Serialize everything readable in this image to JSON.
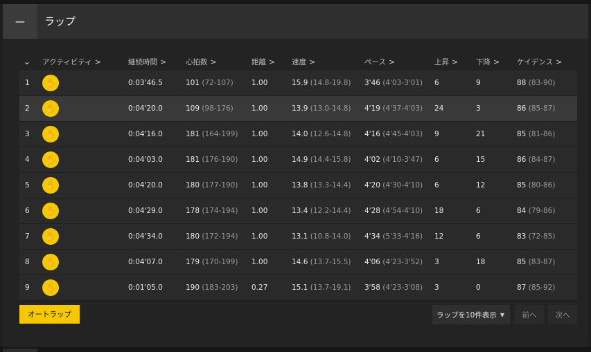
{
  "panel": {
    "title": "ラップ",
    "collapse_symbol": "−"
  },
  "table": {
    "columns": [
      {
        "label": "アクティビティ"
      },
      {
        "label": "継続時間"
      },
      {
        "label": "心拍数"
      },
      {
        "label": "距離"
      },
      {
        "label": "速度"
      },
      {
        "label": "ペース"
      },
      {
        "label": "上昇"
      },
      {
        "label": "下降"
      },
      {
        "label": "ケイデンス"
      }
    ],
    "chevron": ">",
    "sort_toggle": "⌄",
    "rows": [
      {
        "num": "1",
        "duration": "0:03'46.5",
        "hr": "101",
        "hr_range": "(72-107)",
        "distance": "1.00",
        "speed": "15.9",
        "speed_range": "(14.8-19.8)",
        "pace": "3'46",
        "pace_range": "(4'03-3'01)",
        "ascent": "6",
        "descent": "9",
        "cadence": "88",
        "cadence_range": "(83-90)"
      },
      {
        "num": "2",
        "duration": "0:04'20.0",
        "hr": "109",
        "hr_range": "(98-176)",
        "distance": "1.00",
        "speed": "13.9",
        "speed_range": "(13.0-14.8)",
        "pace": "4'19",
        "pace_range": "(4'37-4'03)",
        "ascent": "24",
        "descent": "3",
        "cadence": "86",
        "cadence_range": "(85-87)"
      },
      {
        "num": "3",
        "duration": "0:04'16.0",
        "hr": "181",
        "hr_range": "(164-199)",
        "distance": "1.00",
        "speed": "14.0",
        "speed_range": "(12.6-14.8)",
        "pace": "4'16",
        "pace_range": "(4'45-4'03)",
        "ascent": "9",
        "descent": "21",
        "cadence": "85",
        "cadence_range": "(81-86)"
      },
      {
        "num": "4",
        "duration": "0:04'03.0",
        "hr": "181",
        "hr_range": "(176-190)",
        "distance": "1.00",
        "speed": "14.9",
        "speed_range": "(14.4-15.8)",
        "pace": "4'02",
        "pace_range": "(4'10-3'47)",
        "ascent": "6",
        "descent": "15",
        "cadence": "86",
        "cadence_range": "(84-87)"
      },
      {
        "num": "5",
        "duration": "0:04'20.0",
        "hr": "180",
        "hr_range": "(177-190)",
        "distance": "1.00",
        "speed": "13.8",
        "speed_range": "(13.3-14.4)",
        "pace": "4'20",
        "pace_range": "(4'30-4'10)",
        "ascent": "6",
        "descent": "12",
        "cadence": "85",
        "cadence_range": "(80-86)"
      },
      {
        "num": "6",
        "duration": "0:04'29.0",
        "hr": "178",
        "hr_range": "(174-194)",
        "distance": "1.00",
        "speed": "13.4",
        "speed_range": "(12.2-14.4)",
        "pace": "4'28",
        "pace_range": "(4'54-4'10)",
        "ascent": "18",
        "descent": "6",
        "cadence": "84",
        "cadence_range": "(79-86)"
      },
      {
        "num": "7",
        "duration": "0:04'34.0",
        "hr": "180",
        "hr_range": "(172-194)",
        "distance": "1.00",
        "speed": "13.1",
        "speed_range": "(10.8-14.0)",
        "pace": "4'34",
        "pace_range": "(5'33-4'16)",
        "ascent": "12",
        "descent": "6",
        "cadence": "83",
        "cadence_range": "(72-85)"
      },
      {
        "num": "8",
        "duration": "0:04'07.0",
        "hr": "179",
        "hr_range": "(170-199)",
        "distance": "1.00",
        "speed": "14.6",
        "speed_range": "(13.7-15.5)",
        "pace": "4'06",
        "pace_range": "(4'23-3'52)",
        "ascent": "3",
        "descent": "18",
        "cadence": "85",
        "cadence_range": "(83-87)"
      },
      {
        "num": "9",
        "duration": "0:01'05.0",
        "hr": "190",
        "hr_range": "(183-203)",
        "distance": "0.27",
        "speed": "15.1",
        "speed_range": "(13.7-19.1)",
        "pace": "3'58",
        "pace_range": "(4'23-3'08)",
        "ascent": "3",
        "descent": "0",
        "cadence": "87",
        "cadence_range": "(85-92)"
      }
    ],
    "highlighted_row": 2,
    "activity_icon": {
      "name": "running-shoe-icon",
      "glyph": "✋",
      "color": "#f5c800"
    }
  },
  "footer": {
    "autolap_label": "オートラップ",
    "per_page_label": "ラップを10件表示",
    "per_page_caret": "▼",
    "prev_label": "前へ",
    "next_label": "次へ"
  },
  "colors": {
    "accent": "#f5c800",
    "background": "#1e1e1e",
    "row": "#2a2a2a",
    "row_highlight": "#393939"
  }
}
